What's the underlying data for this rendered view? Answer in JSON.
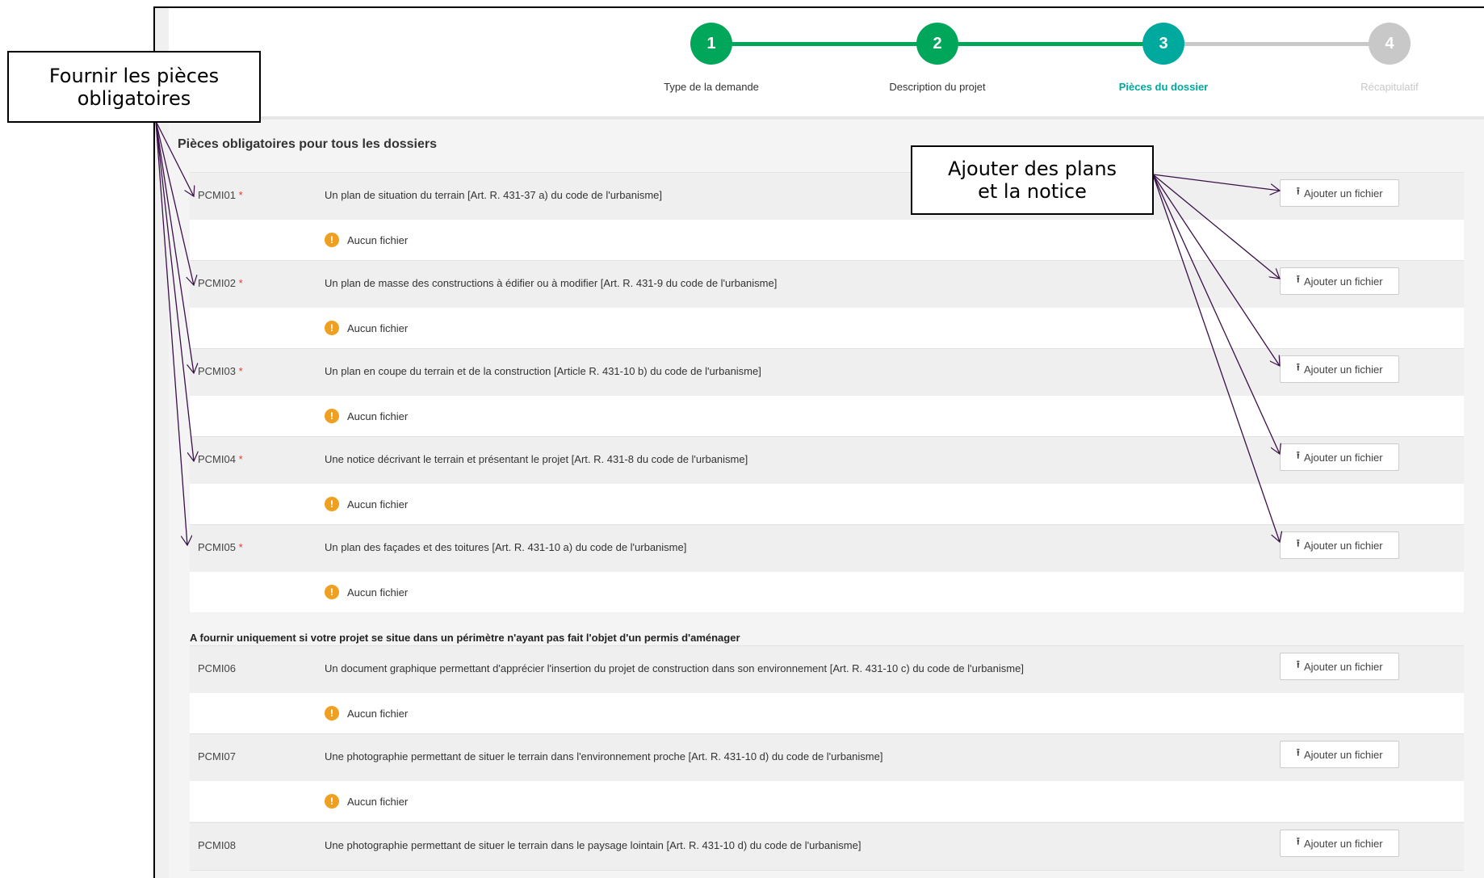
{
  "colors": {
    "done": "#00a65a",
    "current": "#00a99d",
    "todo": "#c8c8c8",
    "annotation_arrow": "#3a1048",
    "warning": "#f0a020",
    "required": "#e03b3b"
  },
  "steps": [
    {
      "number": "1",
      "label": "Type de la demande",
      "state": "done"
    },
    {
      "number": "2",
      "label": "Description du projet",
      "state": "done"
    },
    {
      "number": "3",
      "label": "Pièces du dossier",
      "state": "current"
    },
    {
      "number": "4",
      "label": "Récapitulatif",
      "state": "todo"
    }
  ],
  "section_title": "Pièces obligatoires pour tous les dossiers",
  "subsection_title": "A fournir uniquement si votre projet se situe dans un périmètre n'ayant pas fait l'objet d'un permis d'aménager",
  "upload_label": "Ajouter un fichier",
  "no_file_label": "Aucun fichier",
  "required_mark": "*",
  "documents": [
    {
      "code": "PCMI01",
      "required": true,
      "description": "Un plan de situation du terrain [Art. R. 431-37 a) du code de l'urbanisme]"
    },
    {
      "code": "PCMI02",
      "required": true,
      "description": "Un plan de masse des constructions à édifier ou à modifier [Art. R. 431-9 du code de l'urbanisme]"
    },
    {
      "code": "PCMI03",
      "required": true,
      "description": "Un plan en coupe du terrain et de la construction [Article R. 431-10 b) du code de l'urbanisme]"
    },
    {
      "code": "PCMI04",
      "required": true,
      "description": "Une notice décrivant le terrain et présentant le projet [Art. R. 431-8 du code de l'urbanisme]"
    },
    {
      "code": "PCMI05",
      "required": true,
      "description": "Un plan des façades et des toitures [Art. R. 431-10 a) du code de l'urbanisme]"
    },
    {
      "code": "PCMI06",
      "required": false,
      "description": "Un document graphique permettant d'apprécier l'insertion du projet de construction dans son environnement [Art. R. 431-10 c) du code de l'urbanisme]"
    },
    {
      "code": "PCMI07",
      "required": false,
      "description": "Une photographie permettant de situer le terrain dans l'environnement proche [Art. R. 431-10 d) du code de l'urbanisme]"
    },
    {
      "code": "PCMI08",
      "required": false,
      "description": "Une photographie permettant de situer le terrain dans le paysage lointain [Art. R. 431-10 d) du code de l'urbanisme]"
    }
  ],
  "callouts": {
    "left": "Fournir les pièces obligatoires",
    "right": "Ajouter des plans et la notice"
  }
}
